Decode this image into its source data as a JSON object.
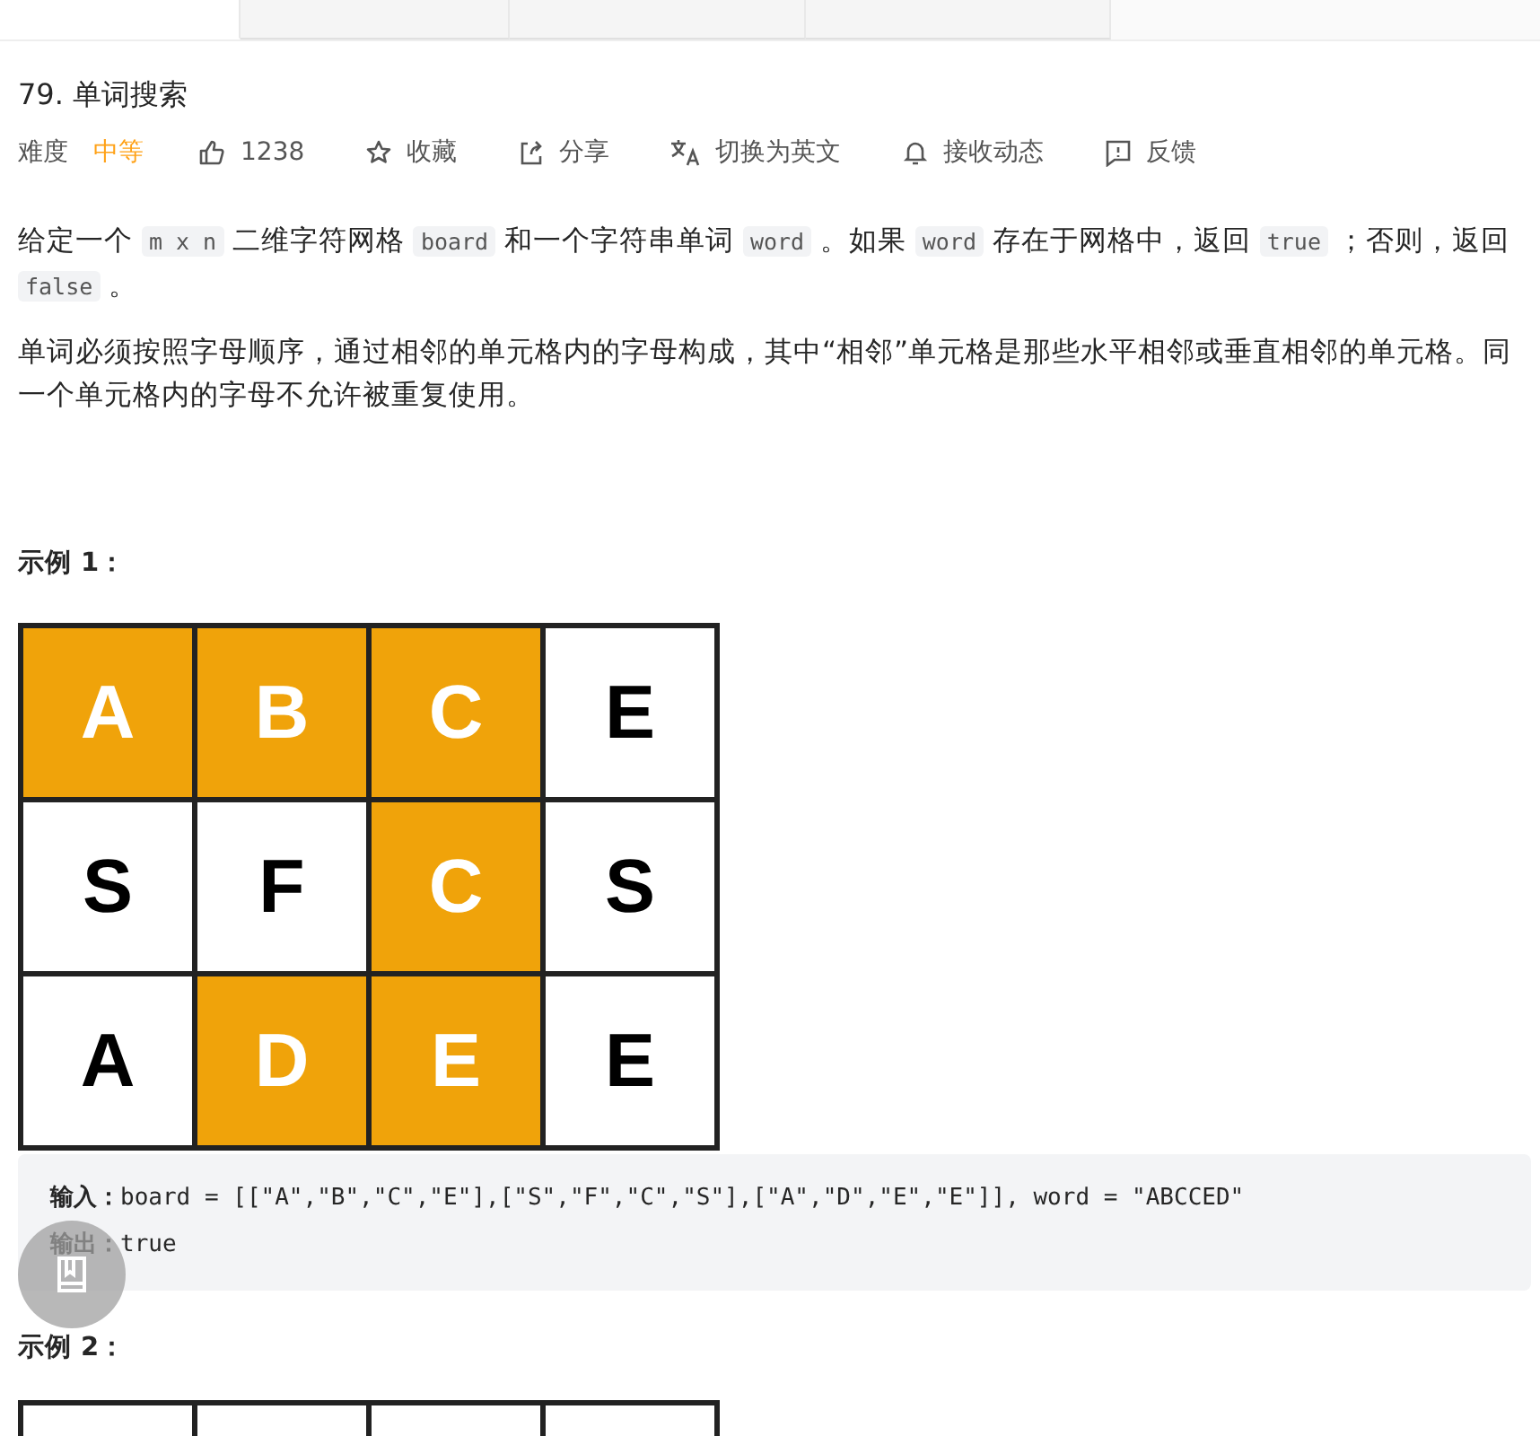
{
  "tabs": [
    {
      "selected": true
    },
    {
      "selected": false
    },
    {
      "selected": false
    },
    {
      "selected": false
    }
  ],
  "title": "79. 单词搜索",
  "meta": {
    "difficulty_label": "难度",
    "difficulty": "中等",
    "likes": "1238",
    "actions": [
      {
        "kind": "star",
        "label": "收藏"
      },
      {
        "kind": "share",
        "label": "分享"
      },
      {
        "kind": "translate",
        "label": "切换为英文"
      },
      {
        "kind": "bell",
        "label": "接收动态"
      },
      {
        "kind": "feedback",
        "label": "反馈"
      }
    ]
  },
  "paragraphs": [
    [
      {
        "kind": "text",
        "text": "给定一个 "
      },
      {
        "kind": "code",
        "text": "m x n"
      },
      {
        "kind": "text",
        "text": " 二维字符网格 "
      },
      {
        "kind": "code",
        "text": "board"
      },
      {
        "kind": "text",
        "text": " 和一个字符串单词 "
      },
      {
        "kind": "code",
        "text": "word"
      },
      {
        "kind": "text",
        "text": " 。如果 "
      },
      {
        "kind": "code",
        "text": "word"
      },
      {
        "kind": "text",
        "text": " 存在于网格中，返回 "
      },
      {
        "kind": "code",
        "text": "true"
      },
      {
        "kind": "text",
        "text": " ；否则，返回 "
      },
      {
        "kind": "code",
        "text": "false"
      },
      {
        "kind": "text",
        "text": " 。"
      }
    ],
    [
      {
        "kind": "text",
        "text": "单词必须按照字母顺序，通过相邻的单元格内的字母构成，其中“相邻”单元格是那些水平相邻或垂直相邻的单元格。同一个单元格内的字母不允许被重复使用。"
      }
    ]
  ],
  "examples": [
    {
      "title": "示例 1：",
      "board": [
        [
          {
            "letter": "A",
            "highlighted": true
          },
          {
            "letter": "B",
            "highlighted": true
          },
          {
            "letter": "C",
            "highlighted": true
          },
          {
            "letter": "E",
            "highlighted": false
          }
        ],
        [
          {
            "letter": "S",
            "highlighted": false
          },
          {
            "letter": "F",
            "highlighted": false
          },
          {
            "letter": "C",
            "highlighted": true
          },
          {
            "letter": "S",
            "highlighted": false
          }
        ],
        [
          {
            "letter": "A",
            "highlighted": false
          },
          {
            "letter": "D",
            "highlighted": true
          },
          {
            "letter": "E",
            "highlighted": true
          },
          {
            "letter": "E",
            "highlighted": false
          }
        ]
      ],
      "input_label": "输入：",
      "input": "board = [[\"A\",\"B\",\"C\",\"E\"],[\"S\",\"F\",\"C\",\"S\"],[\"A\",\"D\",\"E\",\"E\"]], word = \"ABCCED\"",
      "output_label": "输出：",
      "output": "true"
    },
    {
      "title": "示例 2：",
      "board": [
        [
          {
            "highlighted": false
          },
          {
            "highlighted": false
          },
          {
            "highlighted": false
          },
          {
            "highlighted": false
          }
        ]
      ]
    }
  ]
}
